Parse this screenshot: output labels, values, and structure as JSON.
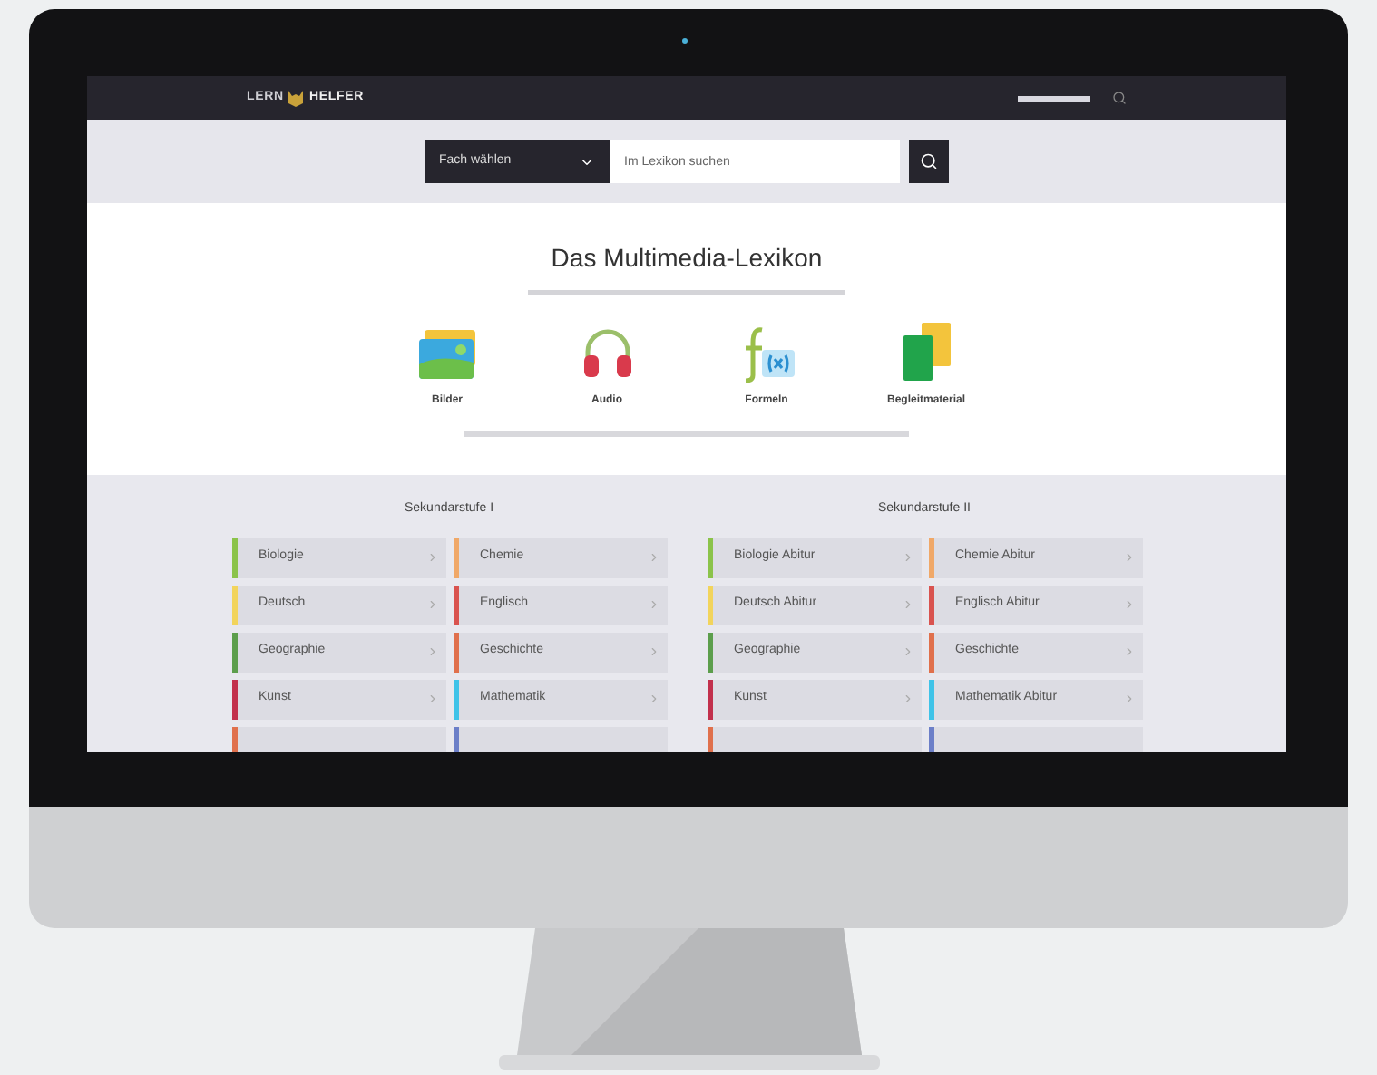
{
  "site": {
    "logo_left": "LERN",
    "logo_right": "HELFER"
  },
  "search": {
    "subject_select": "Fach wählen",
    "placeholder": "Im Lexikon suchen"
  },
  "hero": {
    "title": "Das Multimedia-Lexikon",
    "media": [
      {
        "kind": "images",
        "label": "Bilder"
      },
      {
        "kind": "audio",
        "label": "Audio"
      },
      {
        "kind": "formula",
        "label": "Formeln"
      },
      {
        "kind": "material",
        "label": "Begleitmaterial"
      }
    ]
  },
  "levels": [
    {
      "title": "Sekundarstufe I",
      "subjects": [
        {
          "label": "Biologie",
          "color": "#8bc34a"
        },
        {
          "label": "Chemie",
          "color": "#f0a868"
        },
        {
          "label": "Deutsch",
          "color": "#f2d45c"
        },
        {
          "label": "Englisch",
          "color": "#d9534f"
        },
        {
          "label": "Geographie",
          "color": "#5c9e4c"
        },
        {
          "label": "Geschichte",
          "color": "#e0704c"
        },
        {
          "label": "Kunst",
          "color": "#c2304c"
        },
        {
          "label": "Mathematik",
          "color": "#3fc3e8"
        },
        {
          "color": "#e0704c"
        },
        {
          "color": "#6c7fc8"
        }
      ]
    },
    {
      "title": "Sekundarstufe II",
      "subjects": [
        {
          "label": "Biologie Abitur",
          "color": "#8bc34a"
        },
        {
          "label": "Chemie Abitur",
          "color": "#f0a868"
        },
        {
          "label": "Deutsch Abitur",
          "color": "#f2d45c"
        },
        {
          "label": "Englisch Abitur",
          "color": "#d9534f"
        },
        {
          "label": "Geographie",
          "color": "#5c9e4c"
        },
        {
          "label": "Geschichte",
          "color": "#e0704c"
        },
        {
          "label": "Kunst",
          "color": "#c2304c"
        },
        {
          "label": "Mathematik Abitur",
          "color": "#3fc3e8"
        },
        {
          "color": "#e0704c"
        },
        {
          "color": "#6c7fc8"
        }
      ]
    }
  ]
}
